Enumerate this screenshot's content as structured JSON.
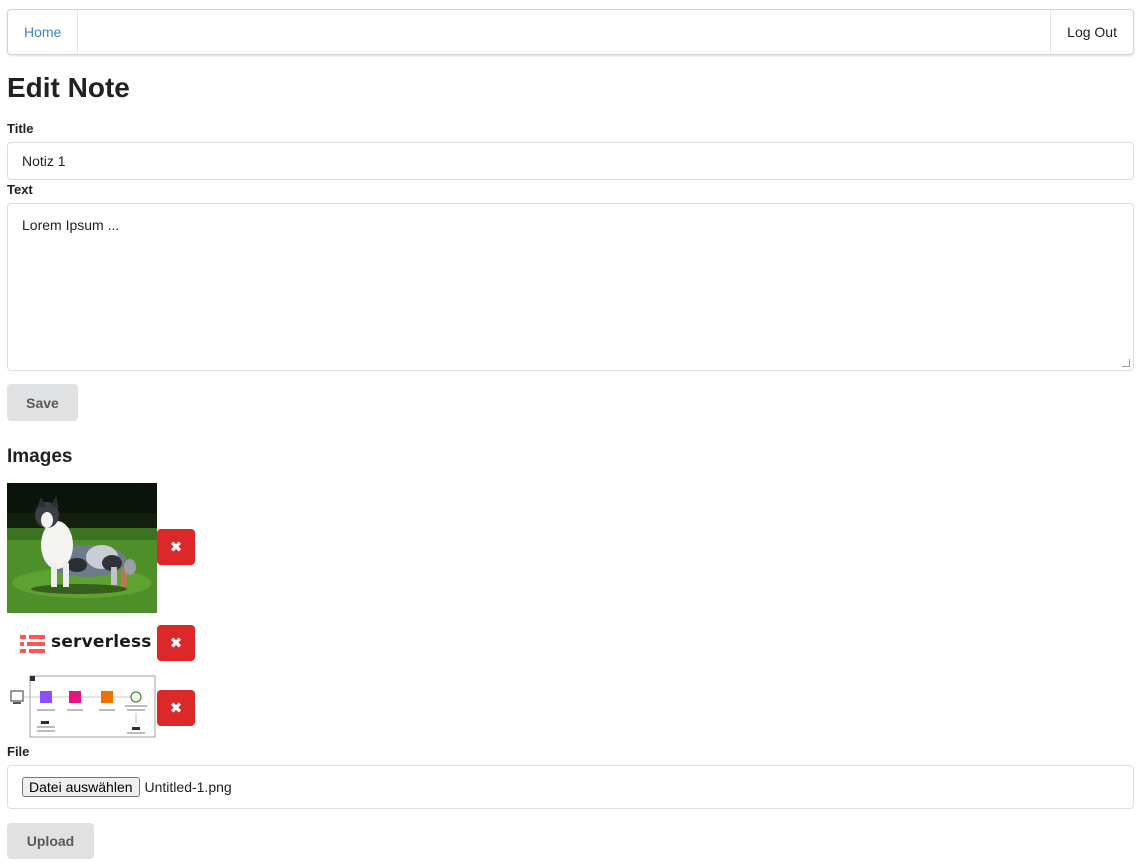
{
  "nav": {
    "home_label": "Home",
    "logout_label": "Log Out"
  },
  "page": {
    "title": "Edit Note"
  },
  "form": {
    "title_label": "Title",
    "title_value": "Notiz 1",
    "text_label": "Text",
    "text_value": "Lorem Ipsum ...",
    "save_label": "Save"
  },
  "images": {
    "heading": "Images",
    "delete_glyph": "✖",
    "items": [
      {
        "kind": "photo",
        "icon": "dog-photo"
      },
      {
        "kind": "logo",
        "icon": "serverless-logo",
        "logo_text": "serverless"
      },
      {
        "kind": "diagram",
        "icon": "architecture-diagram"
      }
    ]
  },
  "upload": {
    "file_label": "File",
    "choose_label": "Datei auswählen",
    "file_name": "Untitled-1.png",
    "upload_label": "Upload"
  },
  "colors": {
    "link": "#4183c4",
    "danger": "#db2828",
    "button_grey": "#e0e1e2",
    "serverless_red": "#fd5750"
  }
}
